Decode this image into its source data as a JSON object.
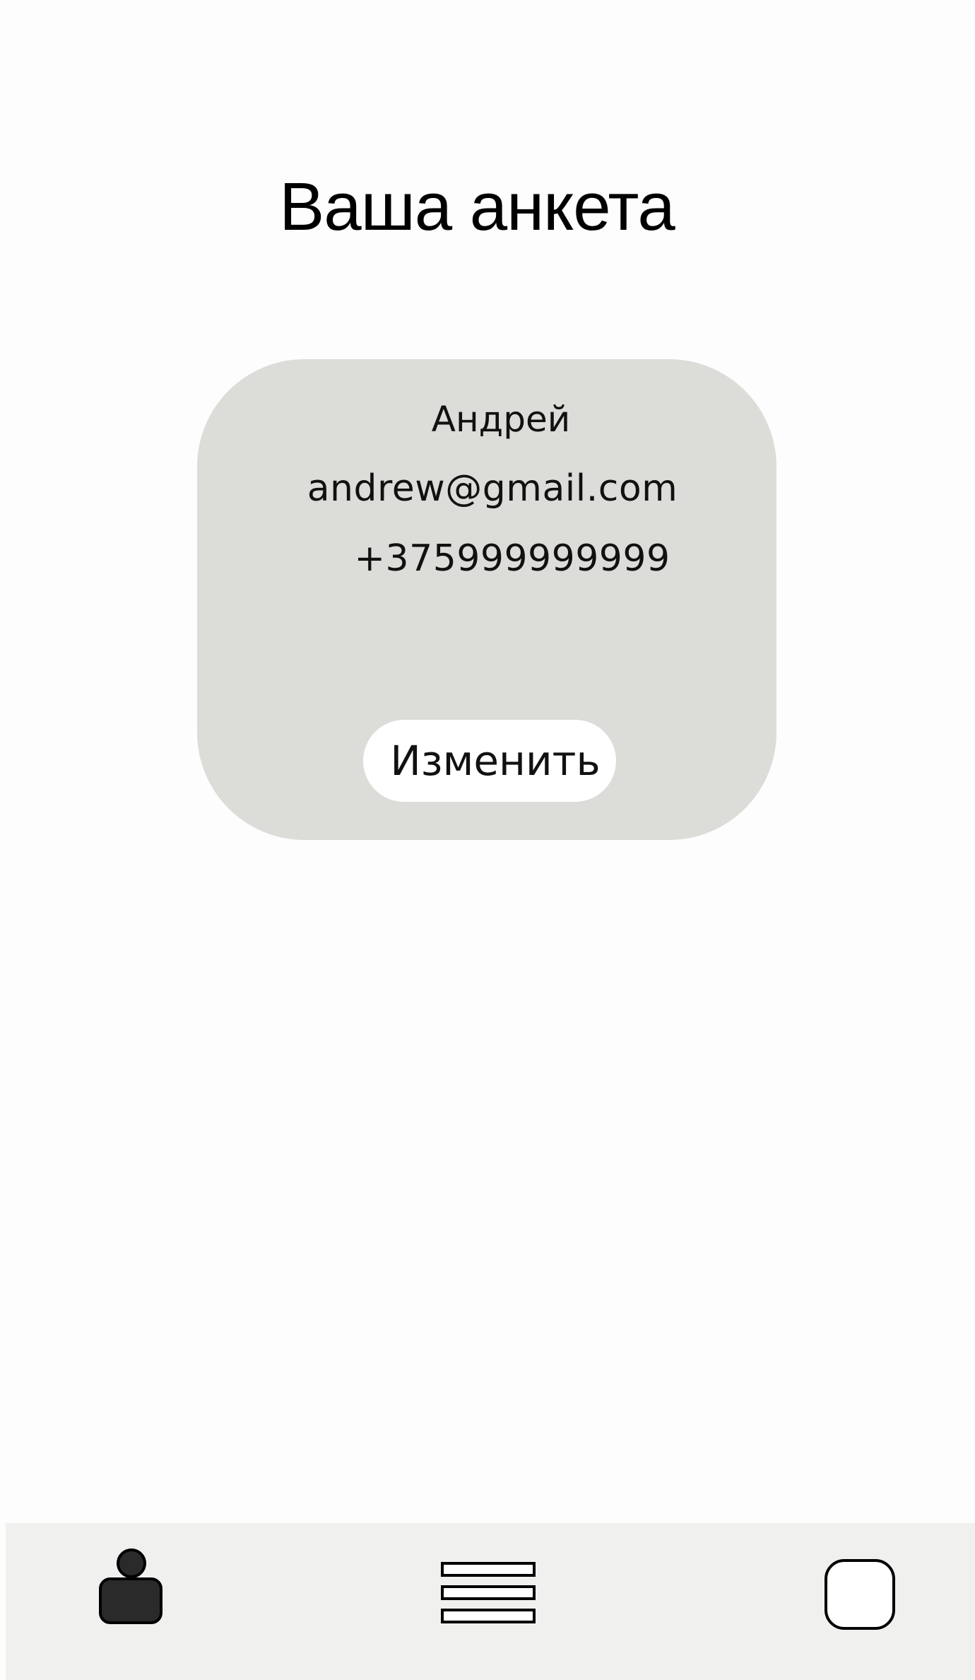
{
  "header": {
    "title": "Ваша анкета"
  },
  "profile_card": {
    "name": "Андрей",
    "email": "andrew@gmail.com",
    "phone": "+375999999999",
    "edit_button_label": "Изменить"
  },
  "bottom_nav": {
    "items": [
      {
        "icon": "profile-icon",
        "active": true
      },
      {
        "icon": "list-icon",
        "active": false
      },
      {
        "icon": "square-icon",
        "active": false
      }
    ]
  },
  "colors": {
    "card_background": "#dcdcd8",
    "bottom_bar_background": "#f0f0ee",
    "active_icon_fill": "#2a2a2a"
  }
}
